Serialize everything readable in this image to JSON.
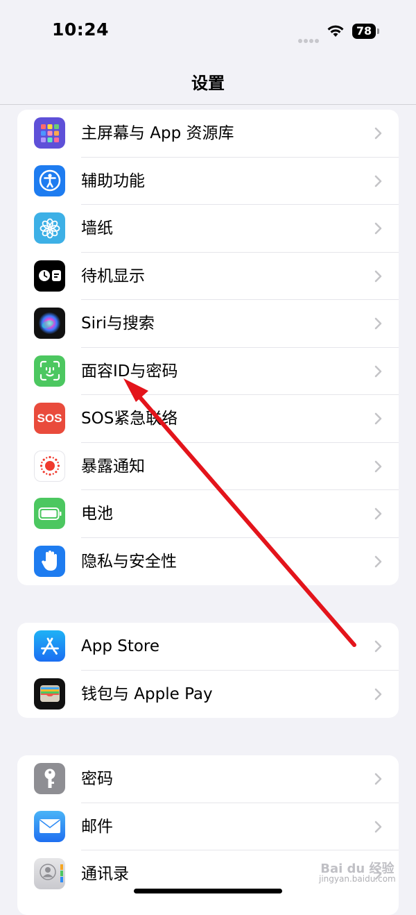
{
  "status_bar": {
    "time": "10:24",
    "battery": "78"
  },
  "nav": {
    "title": "设置"
  },
  "groups": [
    {
      "rows": [
        {
          "label": "主屏幕与 App 资源库",
          "icon": "home-screen-grid-icon",
          "color": "#5e50d8"
        },
        {
          "label": "辅助功能",
          "icon": "accessibility-icon",
          "color": "#1e7cf0"
        },
        {
          "label": "墙纸",
          "icon": "wallpaper-flower-icon",
          "color": "#3db0e6"
        },
        {
          "label": "待机显示",
          "icon": "standby-icon",
          "color": "#000000"
        },
        {
          "label": "Siri与搜索",
          "icon": "siri-icon",
          "color": "#1a1a2e"
        },
        {
          "label": "面容ID与密码",
          "icon": "face-id-icon",
          "color": "#4cc760"
        },
        {
          "label": "SOS紧急联络",
          "icon": "sos-icon",
          "icon_text": "SOS",
          "color": "#e94b3c"
        },
        {
          "label": "暴露通知",
          "icon": "exposure-notification-icon",
          "color": "#ffffff"
        },
        {
          "label": "电池",
          "icon": "battery-icon",
          "color": "#4cc760"
        },
        {
          "label": "隐私与安全性",
          "icon": "privacy-hand-icon",
          "color": "#1e7cf0"
        }
      ]
    },
    {
      "rows": [
        {
          "label": "App Store",
          "icon": "app-store-icon",
          "color": "#1e88f5"
        },
        {
          "label": "钱包与 Apple Pay",
          "icon": "wallet-icon",
          "color": "#111111"
        }
      ]
    },
    {
      "rows": [
        {
          "label": "密码",
          "icon": "key-icon",
          "color": "#8e8e93"
        },
        {
          "label": "邮件",
          "icon": "mail-icon",
          "color": "#2f8cf5"
        },
        {
          "label": "通讯录",
          "icon": "contacts-icon",
          "color": "#cfcfd4"
        }
      ]
    }
  ],
  "watermark": {
    "line1": "Bai du 经验",
    "line2": "jingyan.baidu.com"
  }
}
